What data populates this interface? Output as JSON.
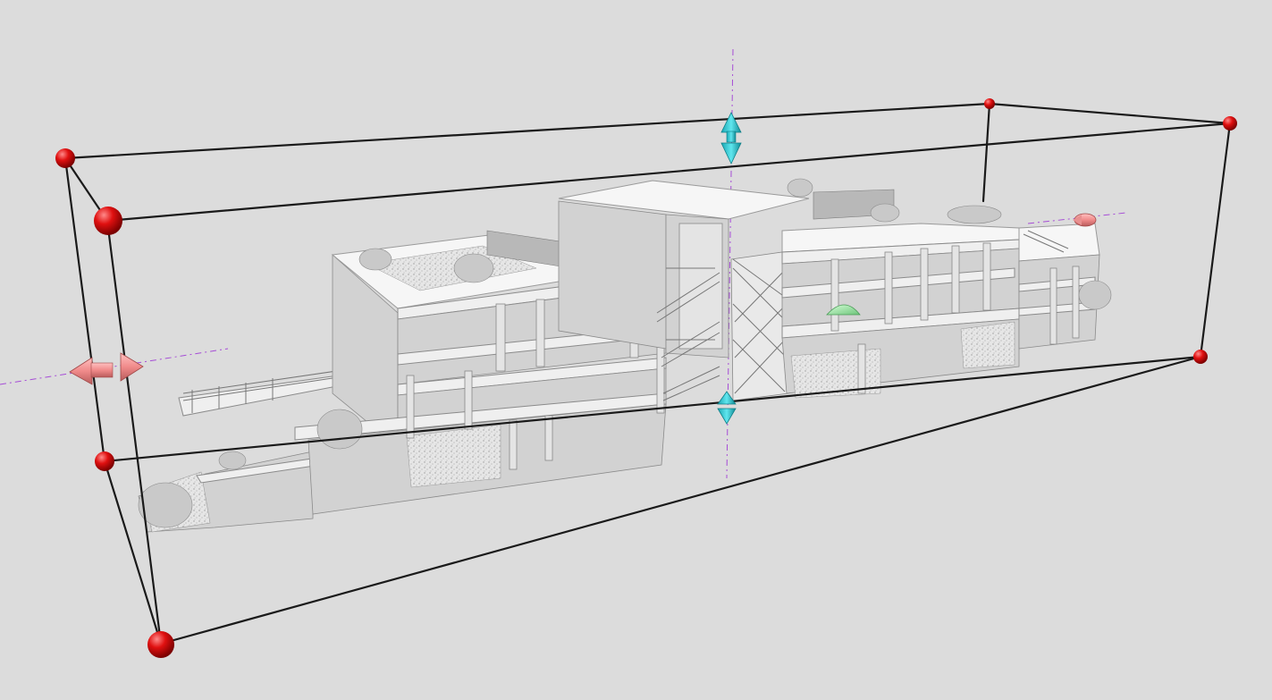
{
  "viewer": {
    "background_color": "#dcdcdc",
    "box_edge_color": "#1a1a1a",
    "corner_handle_color": "#e01010",
    "vertical_arrow_color": "#27c9d6",
    "lateral_arrow_color": "#f08a8a",
    "rotation_handle_color": "#98e0a0",
    "axis_line_color": "#a64dd6",
    "model": "building-point-cloud"
  }
}
